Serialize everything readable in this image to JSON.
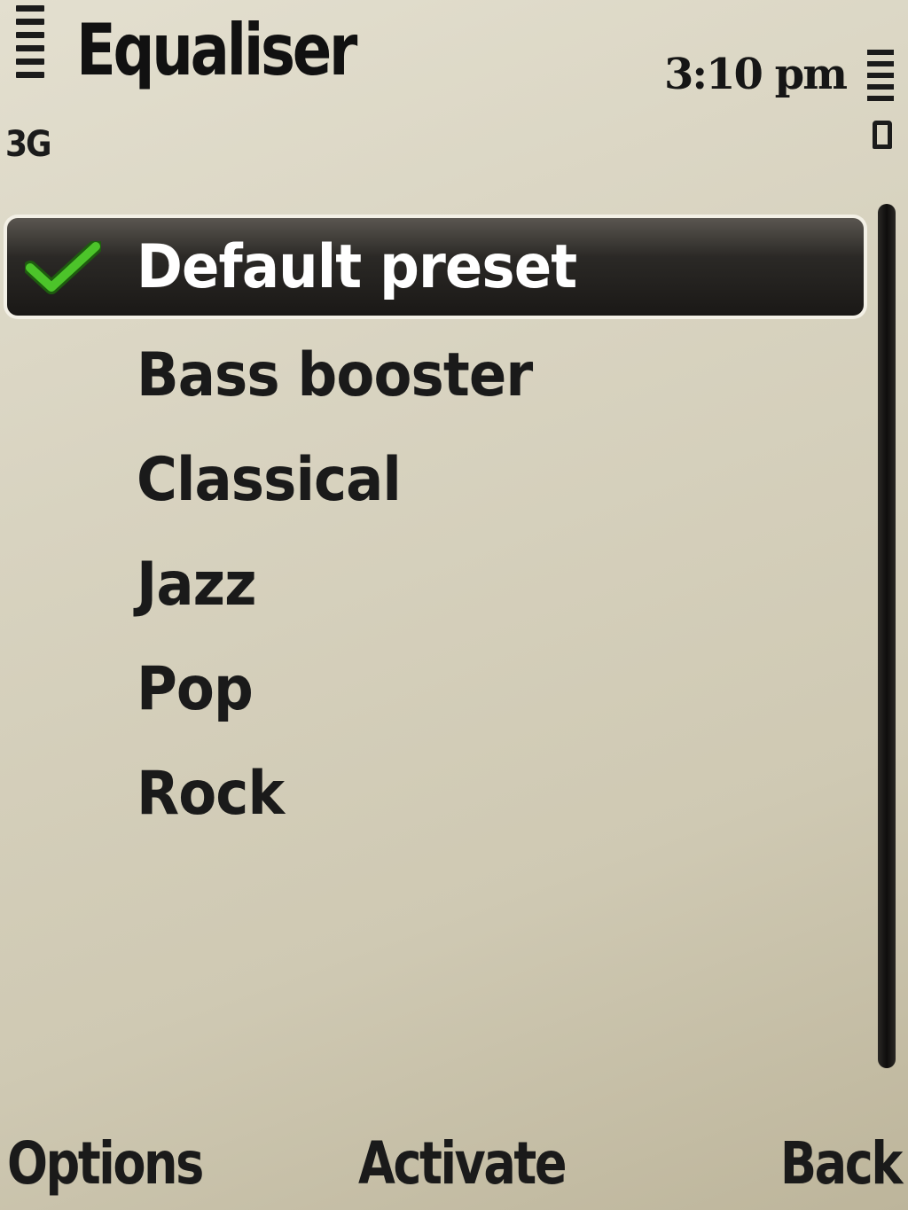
{
  "status_bar": {
    "network": "3G",
    "time": "3:10 pm"
  },
  "header": {
    "title": "Equaliser"
  },
  "presets": {
    "selected_index": 0,
    "items": [
      {
        "label": "Default preset",
        "active": true
      },
      {
        "label": "Bass booster",
        "active": false
      },
      {
        "label": "Classical",
        "active": false
      },
      {
        "label": "Jazz",
        "active": false
      },
      {
        "label": "Pop",
        "active": false
      },
      {
        "label": "Rock",
        "active": false
      }
    ]
  },
  "softkeys": {
    "left": "Options",
    "center": "Activate",
    "right": "Back"
  },
  "colors": {
    "check": "#3aa61e",
    "highlight": "#1f1d1a",
    "background": "#d8d3c0"
  },
  "icons": {
    "signal": "signal-strength-icon",
    "battery": "battery-icon",
    "active_marker": "checkmark-icon"
  }
}
